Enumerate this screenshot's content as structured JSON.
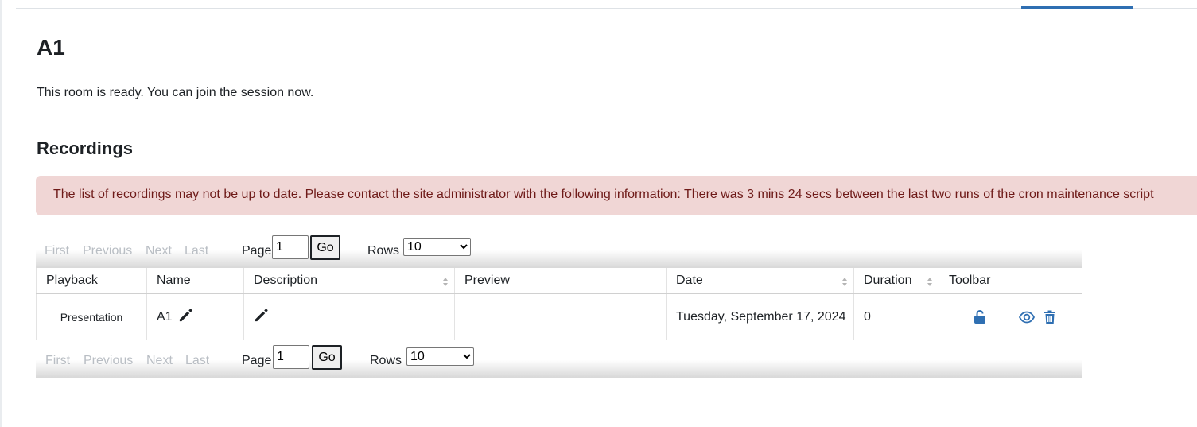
{
  "page": {
    "title": "A1",
    "status_message": "This room is ready. You can join the session now.",
    "recordings_heading": "Recordings",
    "alert": "The list of recordings may not be up to date. Please contact the site administrator with the following information: There was 3 mins 24 secs between the last two runs of the cron maintenance script"
  },
  "pager": {
    "first": "First",
    "previous": "Previous",
    "next": "Next",
    "last": "Last",
    "page_label": "Page",
    "page_value": "1",
    "go_label": "Go",
    "rows_label": "Rows",
    "rows_options": [
      "10"
    ],
    "rows_value": "10"
  },
  "table": {
    "headers": {
      "playback": "Playback",
      "name": "Name",
      "description": "Description",
      "preview": "Preview",
      "date": "Date",
      "duration": "Duration",
      "toolbar": "Toolbar"
    },
    "rows": [
      {
        "playback": "Presentation",
        "name": "A1",
        "description": "",
        "preview": "",
        "date": "Tuesday, September 17, 2024",
        "duration": "0"
      }
    ]
  },
  "icons": {
    "edit_name": "pencil-icon",
    "edit_description": "pencil-icon",
    "unlock": "unlock-icon",
    "view": "eye-icon",
    "delete": "trash-icon"
  },
  "colors": {
    "accent": "#2f6fb2",
    "alert_bg": "#f0d6d5",
    "alert_text": "#6e1a18",
    "disabled_nav": "#b9bec4"
  }
}
